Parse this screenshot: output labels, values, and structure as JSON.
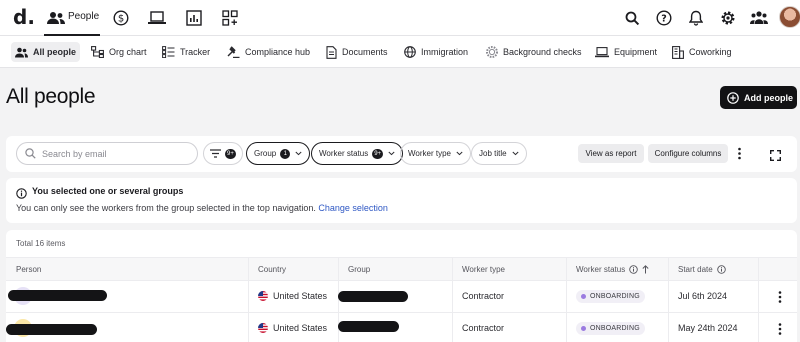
{
  "topnav": {
    "logo": "d.",
    "active_tab_label": "People"
  },
  "subnav": {
    "items": [
      {
        "label": "All people",
        "icon": "people-icon"
      },
      {
        "label": "Org chart",
        "icon": "org-chart-icon"
      },
      {
        "label": "Tracker",
        "icon": "tracker-icon"
      },
      {
        "label": "Compliance hub",
        "icon": "gavel-icon"
      },
      {
        "label": "Documents",
        "icon": "document-icon"
      },
      {
        "label": "Immigration",
        "icon": "globe-icon"
      },
      {
        "label": "Background checks",
        "icon": "badge-check-icon"
      },
      {
        "label": "Equipment",
        "icon": "laptop-icon"
      },
      {
        "label": "Coworking",
        "icon": "building-icon"
      }
    ]
  },
  "page": {
    "title": "All people",
    "add_button": "Add people"
  },
  "filters": {
    "search_placeholder": "Search by email",
    "filter_badge": "9+",
    "group_label": "Group",
    "group_count": "1",
    "worker_status_label": "Worker status",
    "worker_status_count": "9+",
    "worker_type_label": "Worker type",
    "job_title_label": "Job title",
    "view_report": "View as report",
    "configure_columns": "Configure columns"
  },
  "notice": {
    "title": "You selected one or several groups",
    "body": "You can only see the workers from the group selected in the top navigation.",
    "link": "Change selection"
  },
  "table": {
    "total": "Total 16 items",
    "columns": [
      "Person",
      "Country",
      "Group",
      "Worker type",
      "Worker status",
      "Start date"
    ],
    "rows": [
      {
        "country": "United States",
        "worker_type": "Contractor",
        "status": "ONBOARDING",
        "start_date": "Jul 6th 2024"
      },
      {
        "country": "United States",
        "worker_type": "Contractor",
        "status": "ONBOARDING",
        "start_date": "May 24th 2024"
      }
    ]
  },
  "colors": {
    "accent_dark": "#121214",
    "link": "#2f58c4",
    "status_dot": "#9b7be0"
  }
}
